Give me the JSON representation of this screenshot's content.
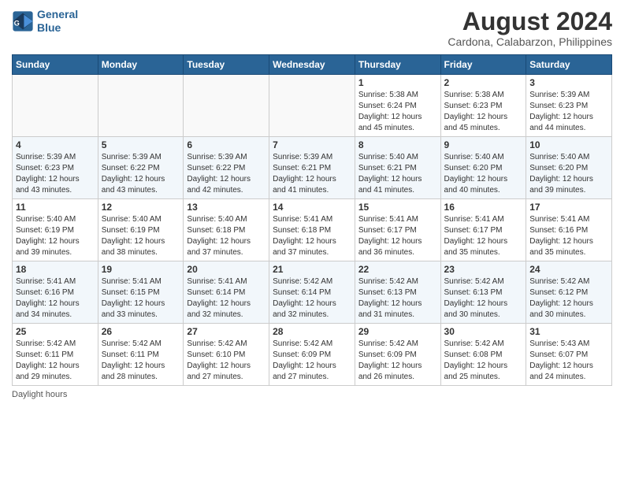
{
  "logo": {
    "line1": "General",
    "line2": "Blue"
  },
  "header": {
    "month": "August 2024",
    "location": "Cardona, Calabarzon, Philippines"
  },
  "weekdays": [
    "Sunday",
    "Monday",
    "Tuesday",
    "Wednesday",
    "Thursday",
    "Friday",
    "Saturday"
  ],
  "weeks": [
    [
      {
        "day": "",
        "empty": true
      },
      {
        "day": "",
        "empty": true
      },
      {
        "day": "",
        "empty": true
      },
      {
        "day": "",
        "empty": true
      },
      {
        "day": "1",
        "info": "Sunrise: 5:38 AM\nSunset: 6:24 PM\nDaylight: 12 hours\nand 45 minutes."
      },
      {
        "day": "2",
        "info": "Sunrise: 5:38 AM\nSunset: 6:23 PM\nDaylight: 12 hours\nand 45 minutes."
      },
      {
        "day": "3",
        "info": "Sunrise: 5:39 AM\nSunset: 6:23 PM\nDaylight: 12 hours\nand 44 minutes."
      }
    ],
    [
      {
        "day": "4",
        "info": "Sunrise: 5:39 AM\nSunset: 6:23 PM\nDaylight: 12 hours\nand 43 minutes."
      },
      {
        "day": "5",
        "info": "Sunrise: 5:39 AM\nSunset: 6:22 PM\nDaylight: 12 hours\nand 43 minutes."
      },
      {
        "day": "6",
        "info": "Sunrise: 5:39 AM\nSunset: 6:22 PM\nDaylight: 12 hours\nand 42 minutes."
      },
      {
        "day": "7",
        "info": "Sunrise: 5:39 AM\nSunset: 6:21 PM\nDaylight: 12 hours\nand 41 minutes."
      },
      {
        "day": "8",
        "info": "Sunrise: 5:40 AM\nSunset: 6:21 PM\nDaylight: 12 hours\nand 41 minutes."
      },
      {
        "day": "9",
        "info": "Sunrise: 5:40 AM\nSunset: 6:20 PM\nDaylight: 12 hours\nand 40 minutes."
      },
      {
        "day": "10",
        "info": "Sunrise: 5:40 AM\nSunset: 6:20 PM\nDaylight: 12 hours\nand 39 minutes."
      }
    ],
    [
      {
        "day": "11",
        "info": "Sunrise: 5:40 AM\nSunset: 6:19 PM\nDaylight: 12 hours\nand 39 minutes."
      },
      {
        "day": "12",
        "info": "Sunrise: 5:40 AM\nSunset: 6:19 PM\nDaylight: 12 hours\nand 38 minutes."
      },
      {
        "day": "13",
        "info": "Sunrise: 5:40 AM\nSunset: 6:18 PM\nDaylight: 12 hours\nand 37 minutes."
      },
      {
        "day": "14",
        "info": "Sunrise: 5:41 AM\nSunset: 6:18 PM\nDaylight: 12 hours\nand 37 minutes."
      },
      {
        "day": "15",
        "info": "Sunrise: 5:41 AM\nSunset: 6:17 PM\nDaylight: 12 hours\nand 36 minutes."
      },
      {
        "day": "16",
        "info": "Sunrise: 5:41 AM\nSunset: 6:17 PM\nDaylight: 12 hours\nand 35 minutes."
      },
      {
        "day": "17",
        "info": "Sunrise: 5:41 AM\nSunset: 6:16 PM\nDaylight: 12 hours\nand 35 minutes."
      }
    ],
    [
      {
        "day": "18",
        "info": "Sunrise: 5:41 AM\nSunset: 6:16 PM\nDaylight: 12 hours\nand 34 minutes."
      },
      {
        "day": "19",
        "info": "Sunrise: 5:41 AM\nSunset: 6:15 PM\nDaylight: 12 hours\nand 33 minutes."
      },
      {
        "day": "20",
        "info": "Sunrise: 5:41 AM\nSunset: 6:14 PM\nDaylight: 12 hours\nand 32 minutes."
      },
      {
        "day": "21",
        "info": "Sunrise: 5:42 AM\nSunset: 6:14 PM\nDaylight: 12 hours\nand 32 minutes."
      },
      {
        "day": "22",
        "info": "Sunrise: 5:42 AM\nSunset: 6:13 PM\nDaylight: 12 hours\nand 31 minutes."
      },
      {
        "day": "23",
        "info": "Sunrise: 5:42 AM\nSunset: 6:13 PM\nDaylight: 12 hours\nand 30 minutes."
      },
      {
        "day": "24",
        "info": "Sunrise: 5:42 AM\nSunset: 6:12 PM\nDaylight: 12 hours\nand 30 minutes."
      }
    ],
    [
      {
        "day": "25",
        "info": "Sunrise: 5:42 AM\nSunset: 6:11 PM\nDaylight: 12 hours\nand 29 minutes."
      },
      {
        "day": "26",
        "info": "Sunrise: 5:42 AM\nSunset: 6:11 PM\nDaylight: 12 hours\nand 28 minutes."
      },
      {
        "day": "27",
        "info": "Sunrise: 5:42 AM\nSunset: 6:10 PM\nDaylight: 12 hours\nand 27 minutes."
      },
      {
        "day": "28",
        "info": "Sunrise: 5:42 AM\nSunset: 6:09 PM\nDaylight: 12 hours\nand 27 minutes."
      },
      {
        "day": "29",
        "info": "Sunrise: 5:42 AM\nSunset: 6:09 PM\nDaylight: 12 hours\nand 26 minutes."
      },
      {
        "day": "30",
        "info": "Sunrise: 5:42 AM\nSunset: 6:08 PM\nDaylight: 12 hours\nand 25 minutes."
      },
      {
        "day": "31",
        "info": "Sunrise: 5:43 AM\nSunset: 6:07 PM\nDaylight: 12 hours\nand 24 minutes."
      }
    ]
  ],
  "footer": "Daylight hours"
}
